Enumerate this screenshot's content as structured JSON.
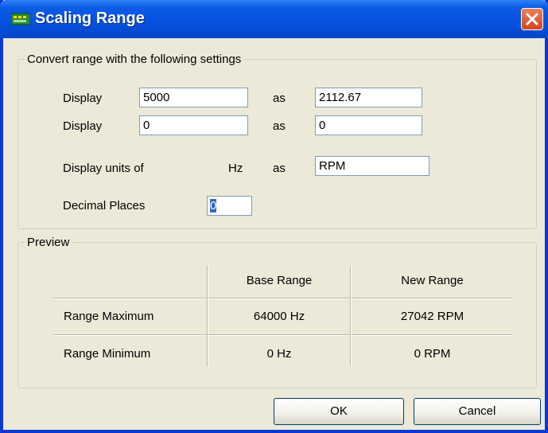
{
  "window": {
    "title": "Scaling Range"
  },
  "conversion_group": {
    "legend": "Convert range with the following settings",
    "rows": [
      {
        "label": "Display",
        "value": "5000",
        "as_label": "as",
        "converted": "2112.67"
      },
      {
        "label": "Display",
        "value": "0",
        "as_label": "as",
        "converted": "0"
      }
    ],
    "units": {
      "label": "Display units of",
      "unit": "Hz",
      "as_label": "as",
      "value": "RPM"
    },
    "decimals": {
      "label": "Decimal Places",
      "value": "0"
    }
  },
  "preview_group": {
    "legend": "Preview",
    "columns": [
      "Base Range",
      "New Range"
    ],
    "rows": [
      {
        "label": "Range Maximum",
        "base": "64000 Hz",
        "new": "27042 RPM"
      },
      {
        "label": "Range Minimum",
        "base": "0 Hz",
        "new": "0 RPM"
      }
    ]
  },
  "buttons": {
    "ok": "OK",
    "cancel": "Cancel"
  },
  "colors": {
    "titlebar": "#0552e0",
    "close": "#d6451c",
    "dialog_bg": "#ece9d8",
    "selection": "#316ac5"
  }
}
